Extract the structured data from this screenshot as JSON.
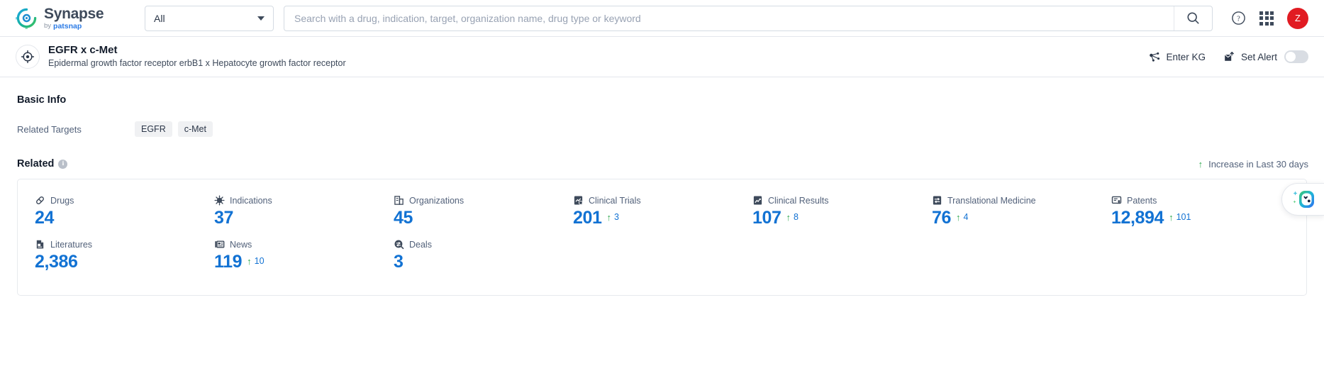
{
  "header": {
    "logo_name": "Synapse",
    "logo_by": "by",
    "logo_brand": "patsnap",
    "scope_value": "All",
    "search_placeholder": "Search with a drug, indication, target, organization name, drug type or keyword",
    "search_value": "",
    "avatar_initial": "Z"
  },
  "entity": {
    "title": "EGFR x c-Met",
    "subtitle": "Epidermal growth factor receptor erbB1 x Hepatocyte growth factor receptor",
    "enter_kg_label": "Enter KG",
    "set_alert_label": "Set Alert",
    "alert_enabled": false
  },
  "basic_info": {
    "section_title": "Basic Info",
    "related_targets_label": "Related Targets",
    "targets": [
      "EGFR",
      "c-Met"
    ]
  },
  "related": {
    "title": "Related",
    "legend": "Increase in Last 30 days",
    "metrics": [
      {
        "icon": "pill-icon",
        "label": "Drugs",
        "value": "24",
        "delta": ""
      },
      {
        "icon": "virus-icon",
        "label": "Indications",
        "value": "37",
        "delta": ""
      },
      {
        "icon": "organization-icon",
        "label": "Organizations",
        "value": "45",
        "delta": ""
      },
      {
        "icon": "clinical-trial-icon",
        "label": "Clinical Trials",
        "value": "201",
        "delta": "3"
      },
      {
        "icon": "clinical-result-icon",
        "label": "Clinical Results",
        "value": "107",
        "delta": "8"
      },
      {
        "icon": "translational-medicine-icon",
        "label": "Translational Medicine",
        "value": "76",
        "delta": "4"
      },
      {
        "icon": "patent-icon",
        "label": "Patents",
        "value": "12,894",
        "delta": "101"
      },
      {
        "icon": "literature-icon",
        "label": "Literatures",
        "value": "2,386",
        "delta": ""
      },
      {
        "icon": "news-icon",
        "label": "News",
        "value": "119",
        "delta": "10"
      },
      {
        "icon": "deal-icon",
        "label": "Deals",
        "value": "3",
        "delta": ""
      }
    ]
  },
  "colors": {
    "accent_blue": "#1272d3",
    "increase_green": "#2fa84f",
    "avatar_red": "#e11b22"
  }
}
